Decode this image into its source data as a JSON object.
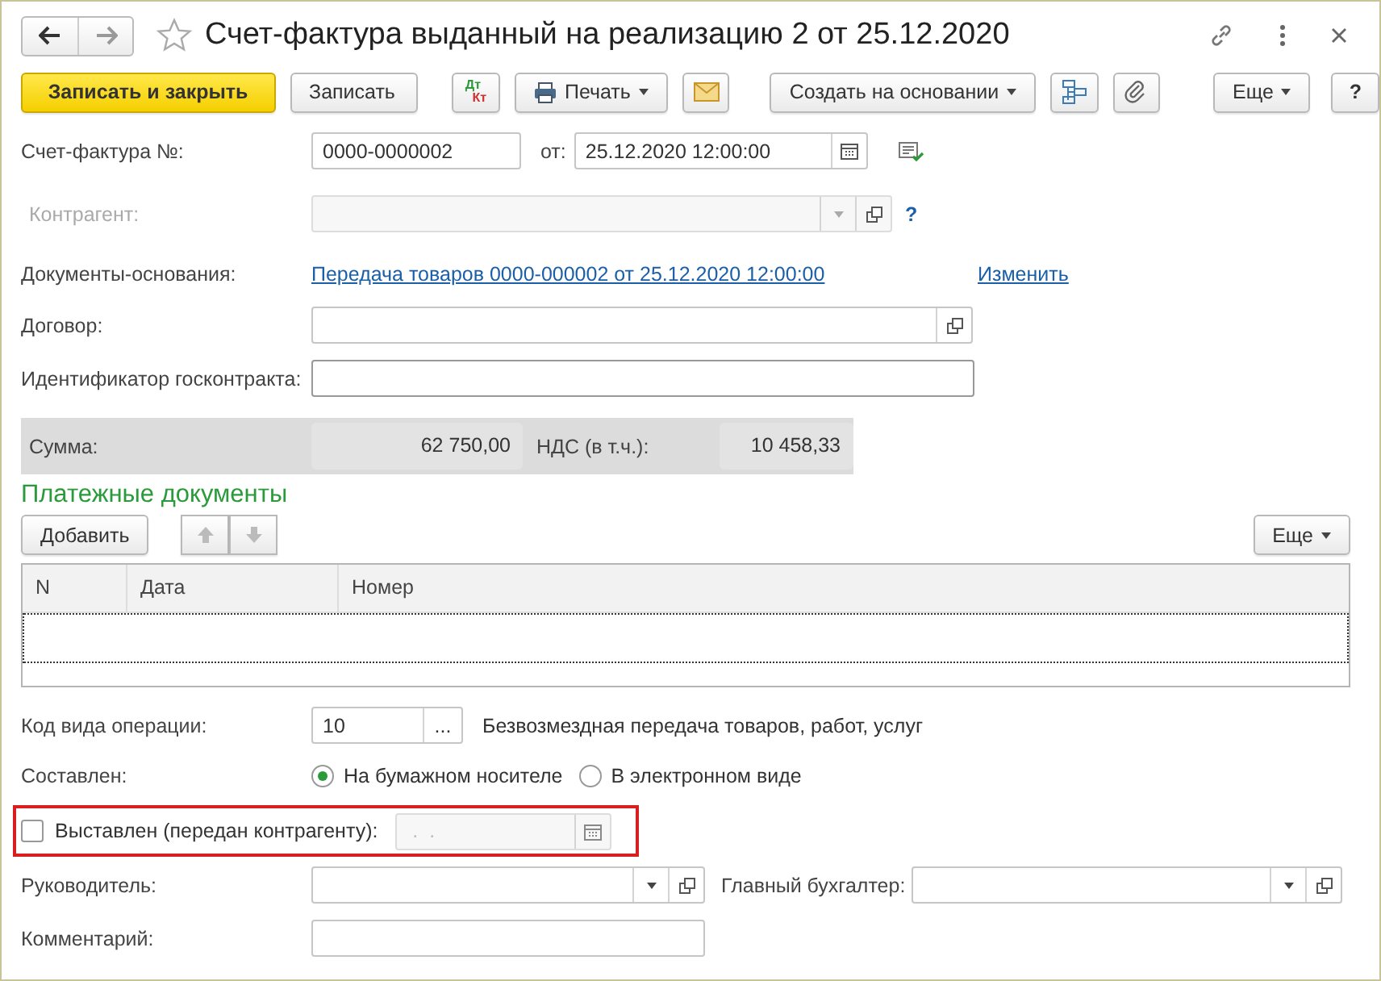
{
  "window": {
    "title": "Счет-фактура выданный на реализацию 2 от 25.12.2020"
  },
  "toolbar": {
    "save_close": "Записать и закрыть",
    "save": "Записать",
    "dt": "Дт",
    "kt": "Кт",
    "print": "Печать",
    "create_based": "Создать на основании",
    "more": "Еще",
    "help": "?"
  },
  "invoice": {
    "label": "Счет-фактура №:",
    "number": "0000-0000002",
    "date_label": "от:",
    "date": "25.12.2020 12:00:00"
  },
  "counterparty": {
    "label": "Контрагент:",
    "disabled": true,
    "help": "?"
  },
  "base_documents": {
    "label": "Документы-основания:",
    "link": "Передача товаров 0000-000002 от 25.12.2020 12:00:00",
    "change": "Изменить"
  },
  "contract": {
    "label": "Договор:"
  },
  "gov_contract": {
    "label": "Идентификатор госконтракта:"
  },
  "totals": {
    "sum_label": "Сумма:",
    "sum": "62 750,00",
    "vat_label": "НДС (в т.ч.):",
    "vat": "10 458,33"
  },
  "payments": {
    "title": "Платежные документы",
    "add": "Добавить",
    "more": "Еще",
    "up_disabled": true,
    "down_disabled": true,
    "columns": [
      "N",
      "Дата",
      "Номер"
    ],
    "rows": [
      {
        "selected": true
      }
    ]
  },
  "operation": {
    "label": "Код вида операции:",
    "code": "10",
    "button": "...",
    "description": "Безвозмездная передача товаров, работ, услуг"
  },
  "composed": {
    "label": "Составлен:",
    "options": [
      {
        "label": "На бумажном носителе",
        "selected": true
      },
      {
        "label": "В электронном виде",
        "selected": false
      }
    ]
  },
  "issued": {
    "label": "Выставлен (передан контрагенту):",
    "checked": false,
    "highlighted": true,
    "date": " .  .",
    "date_disabled": true
  },
  "director": {
    "label": "Руководитель:"
  },
  "accountant": {
    "label": "Главный бухгалтер:"
  },
  "comment": {
    "label": "Комментарий:"
  }
}
